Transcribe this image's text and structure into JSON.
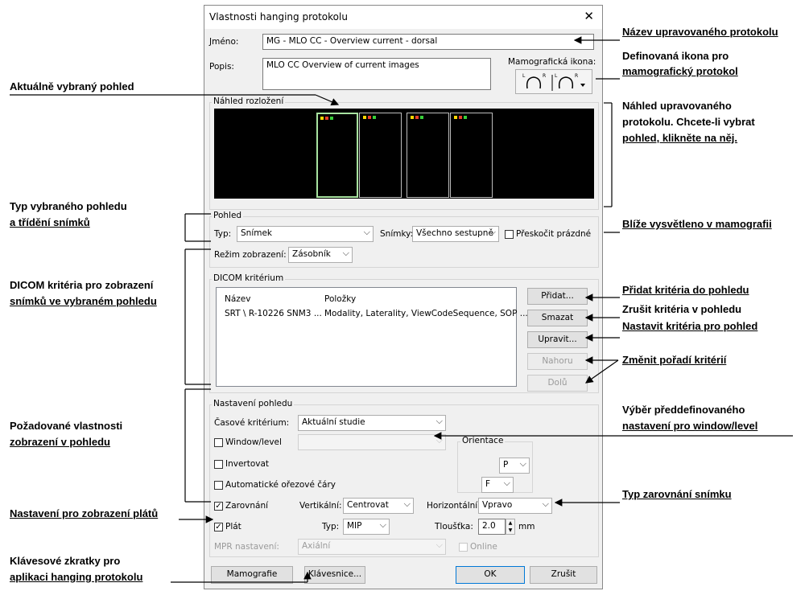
{
  "dialog": {
    "title": "Vlastnosti hanging protokolu",
    "name_label": "Jméno:",
    "name_value": "MG - MLO CC - Overview current - dorsal",
    "desc_label": "Popis:",
    "desc_value": "MLO CC Overview of current images",
    "mammo_icon_label": "Mamografická ikona:",
    "preview_group": "Náhled rozložení",
    "view_group": "Pohled",
    "type_label": "Typ:",
    "type_value": "Snímek",
    "images_label": "Snímky:",
    "images_value": "Všechno sestupně",
    "skip_empty_label": "Přeskočit prázdné",
    "display_mode_label": "Režim zobrazení:",
    "display_mode_value": "Zásobník",
    "dicom_group": "DICOM kritérium",
    "dicom_columns": [
      "Název",
      "Položky"
    ],
    "dicom_rows": [
      {
        "name": "SRT \\ R-10226 SNM3 ...",
        "items": "Modality, Laterality, ViewCodeSequence, SOP ..."
      }
    ],
    "btn_add": "Přidat...",
    "btn_delete": "Smazat",
    "btn_edit": "Upravit...",
    "btn_up": "Nahoru",
    "btn_down": "Dolů",
    "view_settings_group": "Nastavení pohledu",
    "time_criterion_label": "Časové kritérium:",
    "time_criterion_value": "Aktuální studie",
    "window_level_label": "Window/level",
    "orientation_group": "Orientace",
    "orientation_h": "P",
    "orientation_v": "F",
    "invert_label": "Invertovat",
    "auto_cutlines_label": "Automatické ořezové čáry",
    "alignment_label": "Zarovnání",
    "vertical_label": "Vertikální:",
    "vertical_value": "Centrovat",
    "horizontal_label": "Horizontální:",
    "horizontal_value": "Vpravo",
    "slab_label": "Plát",
    "slab_type_label": "Typ:",
    "slab_type_value": "MIP",
    "thickness_label": "Tloušťka:",
    "thickness_value": "2.0",
    "thickness_unit": "mm",
    "mpr_label": "MPR nastavení:",
    "mpr_value": "Axiální",
    "online_label": "Online",
    "btn_mammo": "Mamografie",
    "btn_keyboard": "Klávesnice...",
    "btn_ok": "OK",
    "btn_cancel": "Zrušit"
  },
  "annotations": {
    "right": {
      "protocol_name_1": "Název upravovaného protokolu",
      "icon_def_1": "Definovaná ikona pro",
      "icon_def_2": "mamografický protokol",
      "preview_1": "Náhled upravovaného",
      "preview_2": "protokolu. Chcete-li vybrat",
      "preview_3": "pohled, klikněte na něj.",
      "mammo_more": "Blíže vysvětleno v mamografii",
      "add_crit": "Přidat kritéria do pohledu",
      "del_crit": "Zrušit kritéria v pohledu",
      "set_crit": "Nastavit kritéria pro pohled",
      "order_crit": "Změnit pořadí kritérií",
      "wl_1": "Výběr předdefinovaného",
      "wl_2": "nastavení pro window/level",
      "align": "Typ zarovnání snímku"
    },
    "left": {
      "selected_view": "Aktuálně vybraný pohled",
      "view_type_1": "Typ vybraného pohledu",
      "view_type_2": "a třídění snímků",
      "dicom_1": "DICOM kritéria pro zobrazení",
      "dicom_2": "snímků ve vybraném pohledu",
      "props_1": "Požadované vlastnosti",
      "props_2": "zobrazení v pohledu",
      "slab": "Nastavení pro zobrazení plátů",
      "shortcuts_1": "Klávesové zkratky pro",
      "shortcuts_2": "aplikaci hanging protokolu"
    }
  },
  "colors": {
    "preview_bg": "#000000",
    "selected_view_border": "#a8e3a0",
    "dot_yellow": "#ffd800",
    "dot_red": "#e8402a",
    "dot_green": "#38d13a"
  }
}
